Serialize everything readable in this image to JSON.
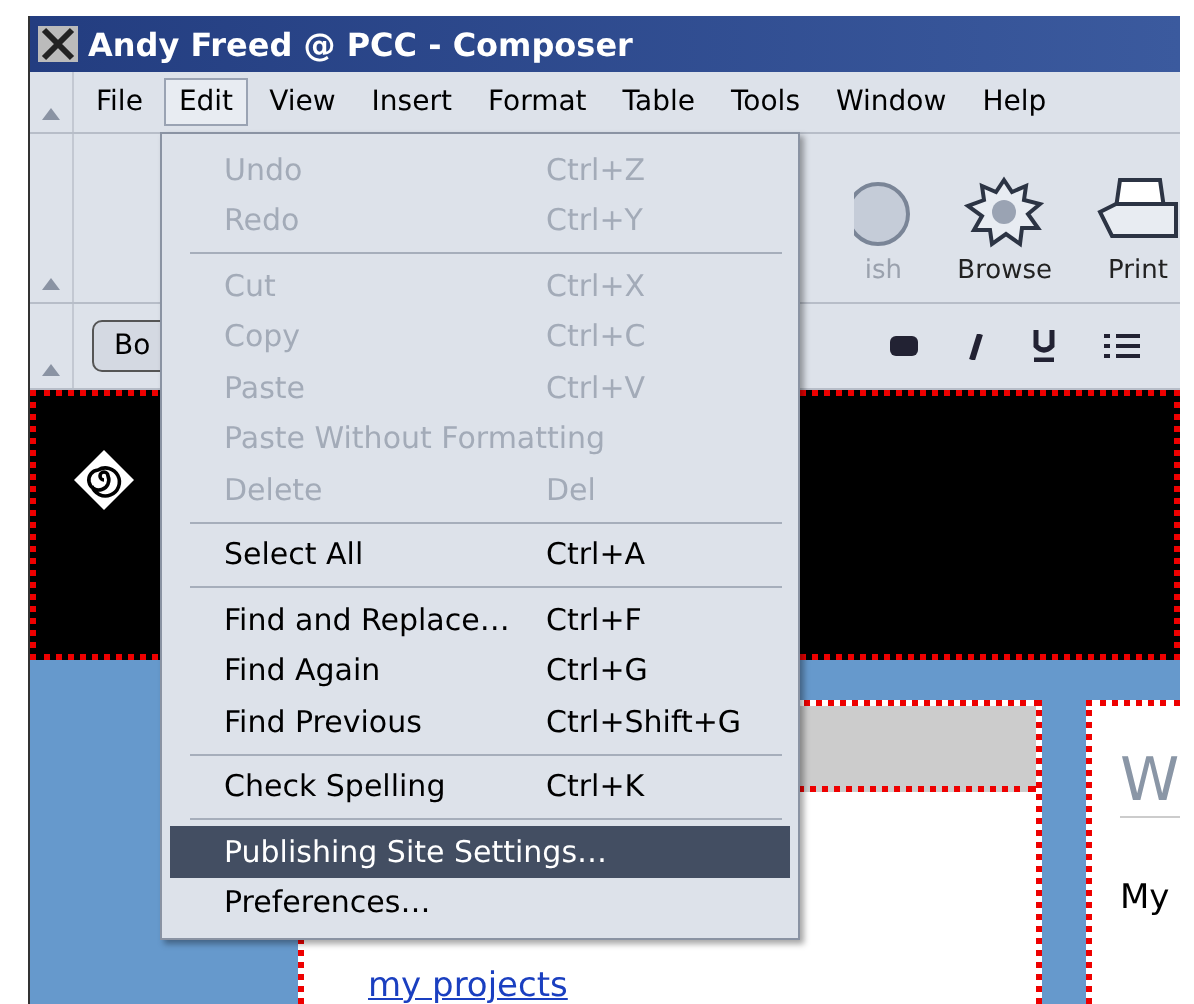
{
  "window": {
    "title": "Andy Freed @ PCC - Composer"
  },
  "menubar": [
    {
      "label": "File",
      "selected": false
    },
    {
      "label": "Edit",
      "selected": true
    },
    {
      "label": "View",
      "selected": false
    },
    {
      "label": "Insert",
      "selected": false
    },
    {
      "label": "Format",
      "selected": false
    },
    {
      "label": "Table",
      "selected": false
    },
    {
      "label": "Tools",
      "selected": false
    },
    {
      "label": "Window",
      "selected": false
    },
    {
      "label": "Help",
      "selected": false
    }
  ],
  "toolbar": {
    "buttons": [
      {
        "label": "ish"
      },
      {
        "label": "Browse"
      },
      {
        "label": "Print"
      }
    ]
  },
  "format_toolbar": {
    "style_button": "Bo"
  },
  "page": {
    "link": "my projects",
    "heading": "W",
    "text": "My"
  },
  "edit_menu": [
    {
      "kind": "item",
      "label": "Undo",
      "shortcut": "Ctrl+Z",
      "disabled": true,
      "selected": false
    },
    {
      "kind": "item",
      "label": "Redo",
      "shortcut": "Ctrl+Y",
      "disabled": true,
      "selected": false
    },
    {
      "kind": "separator"
    },
    {
      "kind": "item",
      "label": "Cut",
      "shortcut": "Ctrl+X",
      "disabled": true,
      "selected": false
    },
    {
      "kind": "item",
      "label": "Copy",
      "shortcut": "Ctrl+C",
      "disabled": true,
      "selected": false
    },
    {
      "kind": "item",
      "label": "Paste",
      "shortcut": "Ctrl+V",
      "disabled": true,
      "selected": false
    },
    {
      "kind": "item",
      "label": "Paste Without Formatting",
      "disabled": true,
      "selected": false
    },
    {
      "kind": "item",
      "label": "Delete",
      "shortcut": "Del",
      "disabled": true,
      "selected": false
    },
    {
      "kind": "separator"
    },
    {
      "kind": "item",
      "label": "Select All",
      "shortcut": "Ctrl+A",
      "disabled": false,
      "selected": false
    },
    {
      "kind": "separator"
    },
    {
      "kind": "item",
      "label": "Find and Replace…",
      "shortcut": "Ctrl+F",
      "disabled": false,
      "selected": false
    },
    {
      "kind": "item",
      "label": "Find Again",
      "shortcut": "Ctrl+G",
      "disabled": false,
      "selected": false
    },
    {
      "kind": "item",
      "label": "Find Previous",
      "shortcut": "Ctrl+Shift+G",
      "disabled": false,
      "selected": false
    },
    {
      "kind": "separator"
    },
    {
      "kind": "item",
      "label": "Check Spelling",
      "shortcut": "Ctrl+K",
      "disabled": false,
      "selected": false
    },
    {
      "kind": "separator"
    },
    {
      "kind": "item",
      "label": "Publishing Site Settings…",
      "disabled": false,
      "selected": true
    },
    {
      "kind": "item",
      "label": "Preferences…",
      "disabled": false,
      "selected": false
    }
  ]
}
